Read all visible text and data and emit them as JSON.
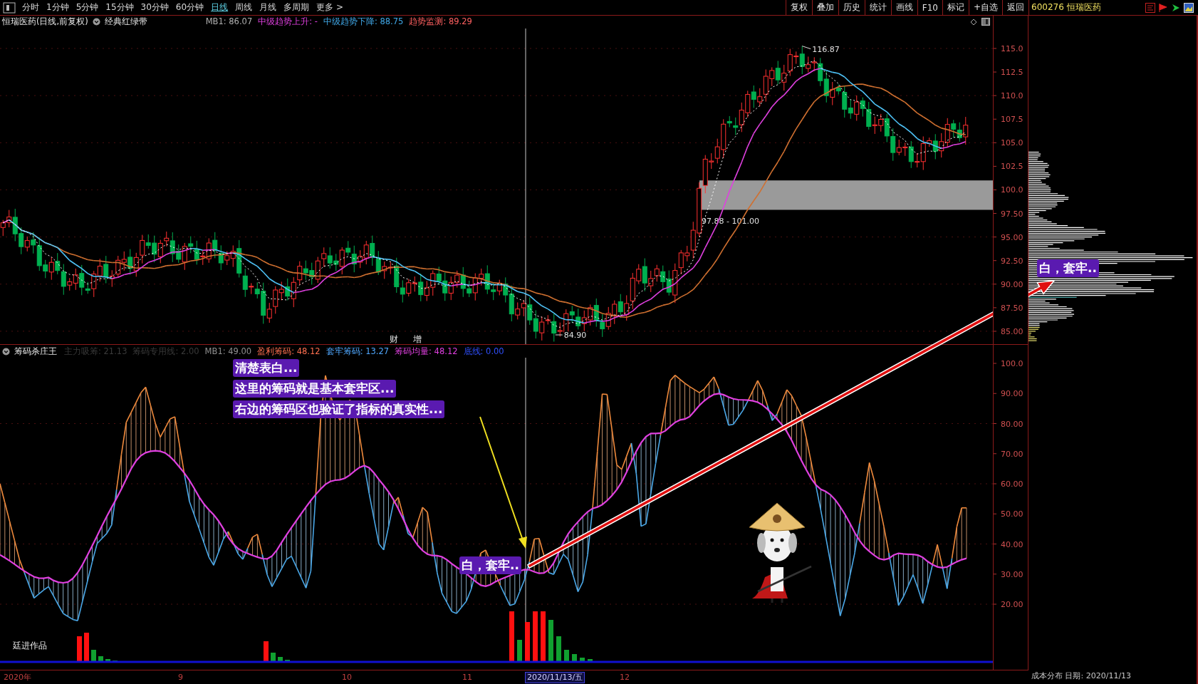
{
  "toolbar": {
    "periods": [
      {
        "label": "分时",
        "selected": false
      },
      {
        "label": "1分钟",
        "selected": false
      },
      {
        "label": "5分钟",
        "selected": false
      },
      {
        "label": "15分钟",
        "selected": false
      },
      {
        "label": "30分钟",
        "selected": false
      },
      {
        "label": "60分钟",
        "selected": false
      },
      {
        "label": "日线",
        "selected": true
      },
      {
        "label": "周线",
        "selected": false
      },
      {
        "label": "月线",
        "selected": false
      },
      {
        "label": "多周期",
        "selected": false
      },
      {
        "label": "更多 >",
        "selected": false
      }
    ],
    "buttons": [
      "复权",
      "叠加",
      "历史",
      "统计",
      "画线",
      "F10",
      "标记",
      "+自选",
      "返回"
    ],
    "stock": "600276 恒瑞医药"
  },
  "main_chart": {
    "title": "恒瑞医药(日线,前复权)",
    "indicator": "经典红绿带",
    "readouts": [
      {
        "text": "MB1: 86.07",
        "color": "#b0b0b0"
      },
      {
        "text": "中级趋势上升: -",
        "color": "#e040e0"
      },
      {
        "text": "中级趋势下降: 88.75",
        "color": "#40a8e8"
      },
      {
        "text": "趋势监测: 89.29",
        "color": "#ff6060"
      }
    ],
    "y_ticks": [
      "115.0",
      "112.5",
      "110.0",
      "107.5",
      "105.0",
      "102.5",
      "100.0",
      "97.50",
      "95.00",
      "92.50",
      "90.00",
      "87.50",
      "85.00"
    ],
    "high_label": "116.87",
    "low_label": "84.90",
    "zone_label": "97.88 - 101.00",
    "event_markers": [
      "财",
      "增"
    ]
  },
  "indicator_panel": {
    "title": "筹码杀庄王",
    "readouts": [
      {
        "text": "主力吸筹: 21.13",
        "color": "#3a3a3a"
      },
      {
        "text": "筹码专用线: 2.00",
        "color": "#3a3a3a"
      },
      {
        "text": "MB1: 49.00",
        "color": "#909090"
      },
      {
        "text": "盈利筹码: 48.12",
        "color": "#ff7050"
      },
      {
        "text": "套牢筹码: 13.27",
        "color": "#50a8ff"
      },
      {
        "text": "筹码均量: 48.12",
        "color": "#e040e0"
      },
      {
        "text": "底线: 0.00",
        "color": "#3050ff"
      }
    ],
    "y_ticks": [
      "100.0",
      "90.00",
      "80.00",
      "70.00",
      "60.00",
      "50.00",
      "40.00",
      "30.00",
      "20.00"
    ],
    "signature": "廷进作品"
  },
  "time_axis": [
    {
      "label": "2020年",
      "selected": false
    },
    {
      "label": "9",
      "selected": false
    },
    {
      "label": "10",
      "selected": false
    },
    {
      "label": "11",
      "selected": false
    },
    {
      "label": "2020/11/13/五",
      "selected": true
    },
    {
      "label": "12",
      "selected": false
    }
  ],
  "cost_distribution": {
    "caption": "成本分布 日期: 2020/11/13"
  },
  "annotations": {
    "note": [
      "清楚表白...",
      "这里的筹码就是基本套牢区...",
      "右边的筹码区也验证了指标的真实性..."
    ],
    "callouts": [
      "白，套牢..",
      "白，套牢.."
    ]
  }
}
